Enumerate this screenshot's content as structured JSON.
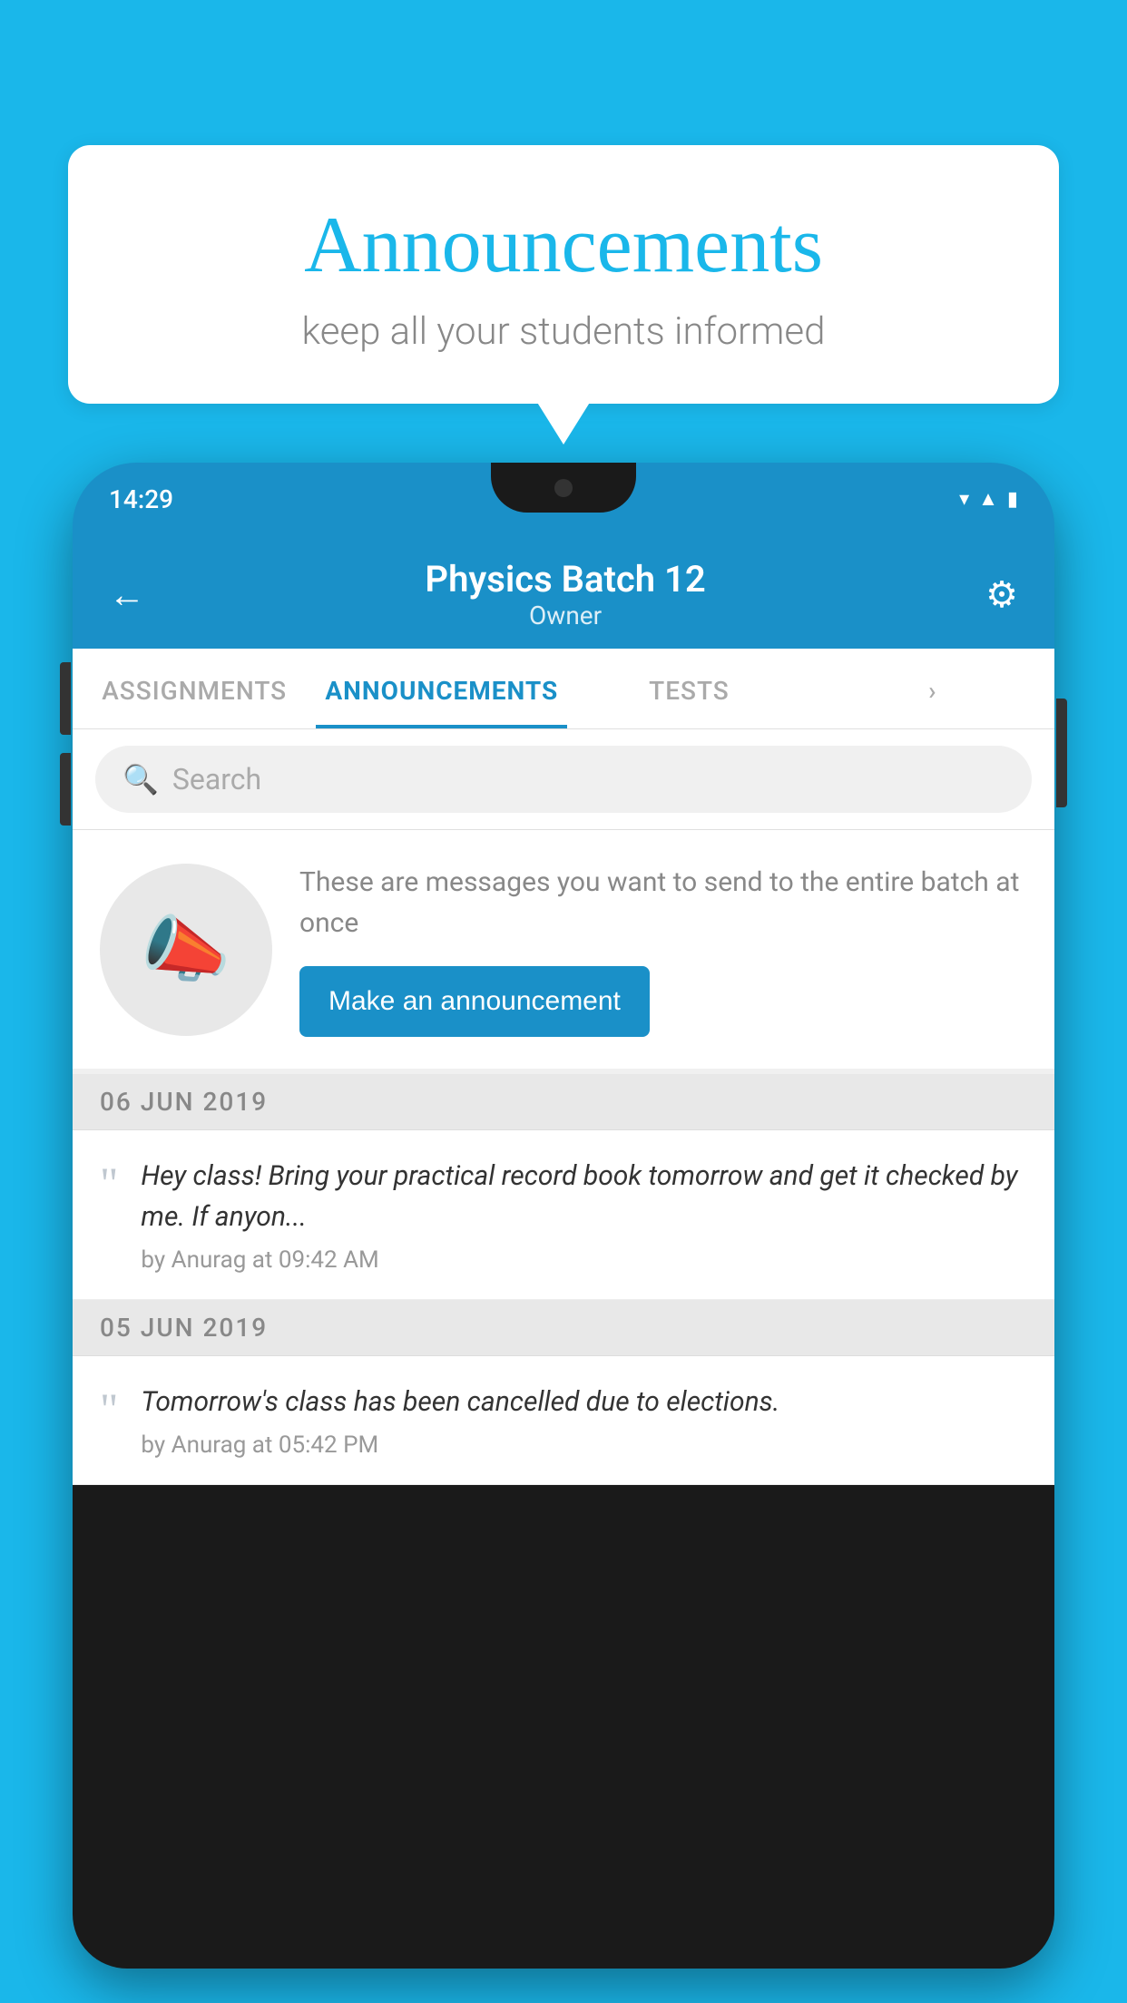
{
  "page": {
    "background_color": "#1ab7ea"
  },
  "speech_bubble": {
    "title": "Announcements",
    "subtitle": "keep all your students informed"
  },
  "phone": {
    "status_bar": {
      "time": "14:29",
      "icons": [
        "wifi",
        "signal",
        "battery"
      ]
    },
    "header": {
      "title": "Physics Batch 12",
      "subtitle": "Owner",
      "back_label": "←",
      "gear_label": "⚙"
    },
    "tabs": [
      {
        "label": "ASSIGNMENTS",
        "active": false
      },
      {
        "label": "ANNOUNCEMENTS",
        "active": true
      },
      {
        "label": "TESTS",
        "active": false
      },
      {
        "label": "...",
        "active": false
      }
    ],
    "search": {
      "placeholder": "Search"
    },
    "announcement_prompt": {
      "description": "These are messages you want to send to the entire batch at once",
      "button_label": "Make an announcement"
    },
    "announcements": [
      {
        "date": "06  JUN  2019",
        "text": "Hey class! Bring your practical record book tomorrow and get it checked by me. If anyon...",
        "meta": "by Anurag at 09:42 AM"
      },
      {
        "date": "05  JUN  2019",
        "text": "Tomorrow's class has been cancelled due to elections.",
        "meta": "by Anurag at 05:42 PM"
      }
    ]
  }
}
